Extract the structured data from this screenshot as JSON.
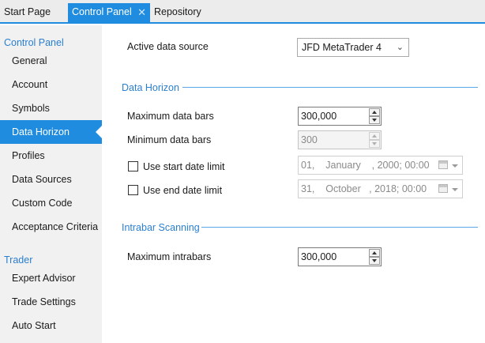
{
  "tabs": {
    "start_page": "Start Page",
    "control_panel": "Control Panel",
    "close_glyph": "✕",
    "repository": "Repository"
  },
  "sidebar": {
    "control_panel_title": "Control Panel",
    "control_panel_items": [
      "General",
      "Account",
      "Symbols",
      "Data Horizon",
      "Profiles",
      "Data Sources",
      "Custom Code",
      "Acceptance Criteria"
    ],
    "selected_item": "Data Horizon",
    "trader_title": "Trader",
    "trader_items": [
      "Expert Advisor",
      "Trade Settings",
      "Auto Start"
    ]
  },
  "main": {
    "active_data_source_label": "Active data source",
    "active_data_source_value": "JFD MetaTrader 4",
    "data_horizon_title": "Data Horizon",
    "max_data_bars_label": "Maximum data bars",
    "max_data_bars_value": "300,000",
    "min_data_bars_label": "Minimum data bars",
    "min_data_bars_value": "300",
    "use_start_date_label": "Use start date limit",
    "use_start_date_checked": false,
    "start_date_value": "01,    January    , 2000; 00:00",
    "use_end_date_label": "Use end date limit",
    "use_end_date_checked": false,
    "end_date_value": "31,    October   , 2018; 00:00",
    "intrabar_title": "Intrabar Scanning",
    "max_intrabars_label": "Maximum intrabars",
    "max_intrabars_value": "300,000"
  },
  "colors": {
    "accent": "#1f8ce0",
    "section_title": "#2b7fcf",
    "sidebar_bg": "#f1f1f1",
    "tabbar_bg": "#ececec"
  }
}
